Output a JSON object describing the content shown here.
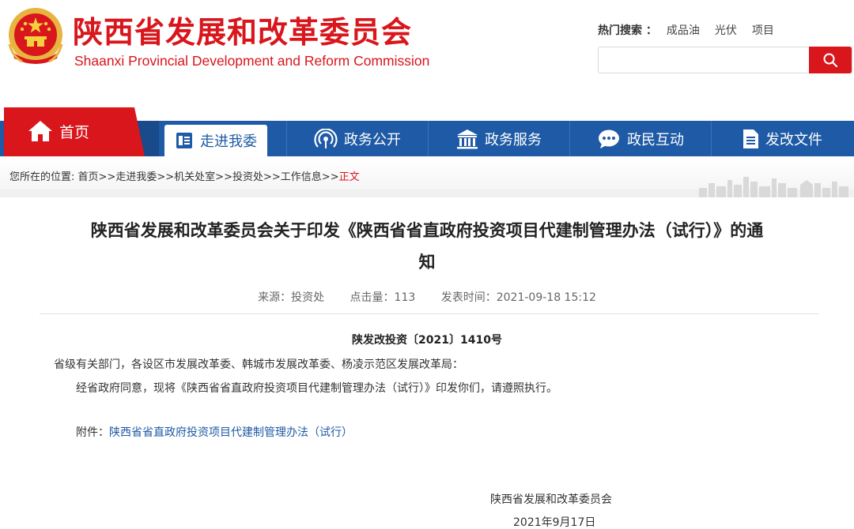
{
  "header": {
    "title_cn": "陕西省发展和改革委员会",
    "title_en": "Shaanxi Provincial Development and Reform Commission",
    "emblem_icon": "national-emblem-icon",
    "hot_search_label": "热门搜索 ：",
    "hot_search_items": [
      "成品油",
      "光伏",
      "项目"
    ],
    "search_placeholder": "",
    "search_icon": "search-icon"
  },
  "nav": {
    "home": "首页",
    "items": [
      {
        "label": "走进我委",
        "icon": "id-card-icon"
      },
      {
        "label": "政务公开",
        "icon": "broadcast-icon"
      },
      {
        "label": "政务服务",
        "icon": "building-icon"
      },
      {
        "label": "政民互动",
        "icon": "chat-bubble-icon"
      },
      {
        "label": "发改文件",
        "icon": "document-icon"
      }
    ]
  },
  "breadcrumb": {
    "prefix": "您所在的位置:",
    "items": [
      "首页",
      "走进我委",
      "机关处室",
      "投资处",
      "工作信息"
    ],
    "sep": ">>",
    "current": "正文"
  },
  "article": {
    "title_line1": "陕西省发展和改革委员会关于印发《陕西省省直政府投资项目代建制管理办法（试行）》的通",
    "title_line2": "知",
    "meta_source": "来源：投资处",
    "meta_clicks": "点击量：113",
    "meta_time": "发表时间：2021-09-18 15:12",
    "doc_number": "陕发改投资〔2021〕1410号",
    "recipients": "省级有关部门，各设区市发展改革委、韩城市发展改革委、杨凌示范区发展改革局：",
    "body": "经省政府同意，现将《陕西省省直政府投资项目代建制管理办法（试行）》印发你们，请遵照执行。",
    "attachment_label": "附件：",
    "attachment_link": "陕西省省直政府投资项目代建制管理办法（试行）",
    "signature_org": "陕西省发展和改革委员会",
    "signature_date": "2021年9月17日"
  },
  "colors": {
    "brand_red": "#d8161c",
    "nav_blue": "#1e5aa5"
  }
}
